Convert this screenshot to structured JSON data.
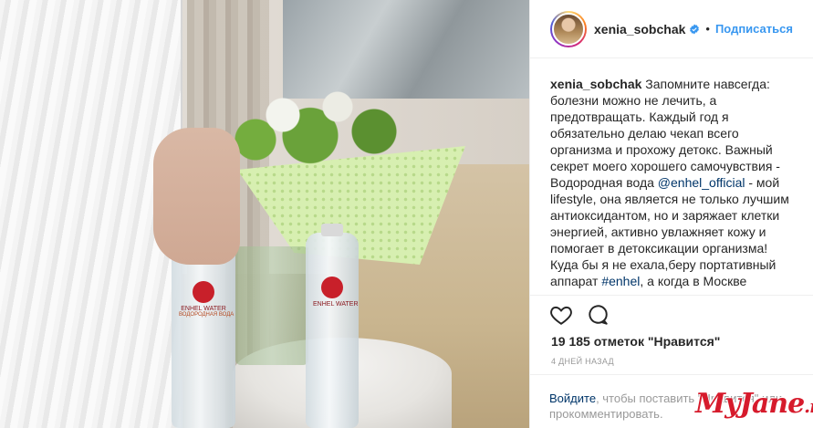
{
  "post": {
    "bottle_brand": "ENHEL WATER",
    "bottle_subtitle": "ВОДОРОДНАЯ ВОДА"
  },
  "header": {
    "username": "xenia_sobchak",
    "verified_icon": "verified-badge-icon",
    "separator": "•",
    "follow_label": "Подписаться"
  },
  "caption": {
    "username": "xenia_sobchak",
    "text_part1": " Запомните навсегда: болезни можно не лечить, а предотвращать. Каждый год я обязательно делаю чекап всего организма и прохожу детокс. Важный секрет моего хорошего самочувствия - Водородная вода ",
    "mention": "@enhel_official",
    "text_part2": " - мой lifestyle, она является не только лучшим антиоксидантом, но и заряжает клетки энергией, активно увлажняет кожу и помогает в детоксикации организма! Куда бы я не ехала,беру портативный аппарат ",
    "hashtag": "#enhel",
    "text_part3": ", а когда в Москве"
  },
  "actions": {
    "like_icon": "heart-icon",
    "comment_icon": "comment-icon"
  },
  "likes_text": "19 185 отметок \"Нравится\"",
  "timestamp": "4 дней назад",
  "login_prompt": {
    "login_link": "Войдите",
    "text": ", чтобы поставить \"Нравится\" или прокомментировать."
  },
  "watermark": {
    "main": "MyJane",
    "suffix": ".ru"
  },
  "colors": {
    "link_blue": "#3897f0",
    "text_dark": "#262626",
    "muted": "#999999",
    "watermark_red": "#d61b2c"
  }
}
